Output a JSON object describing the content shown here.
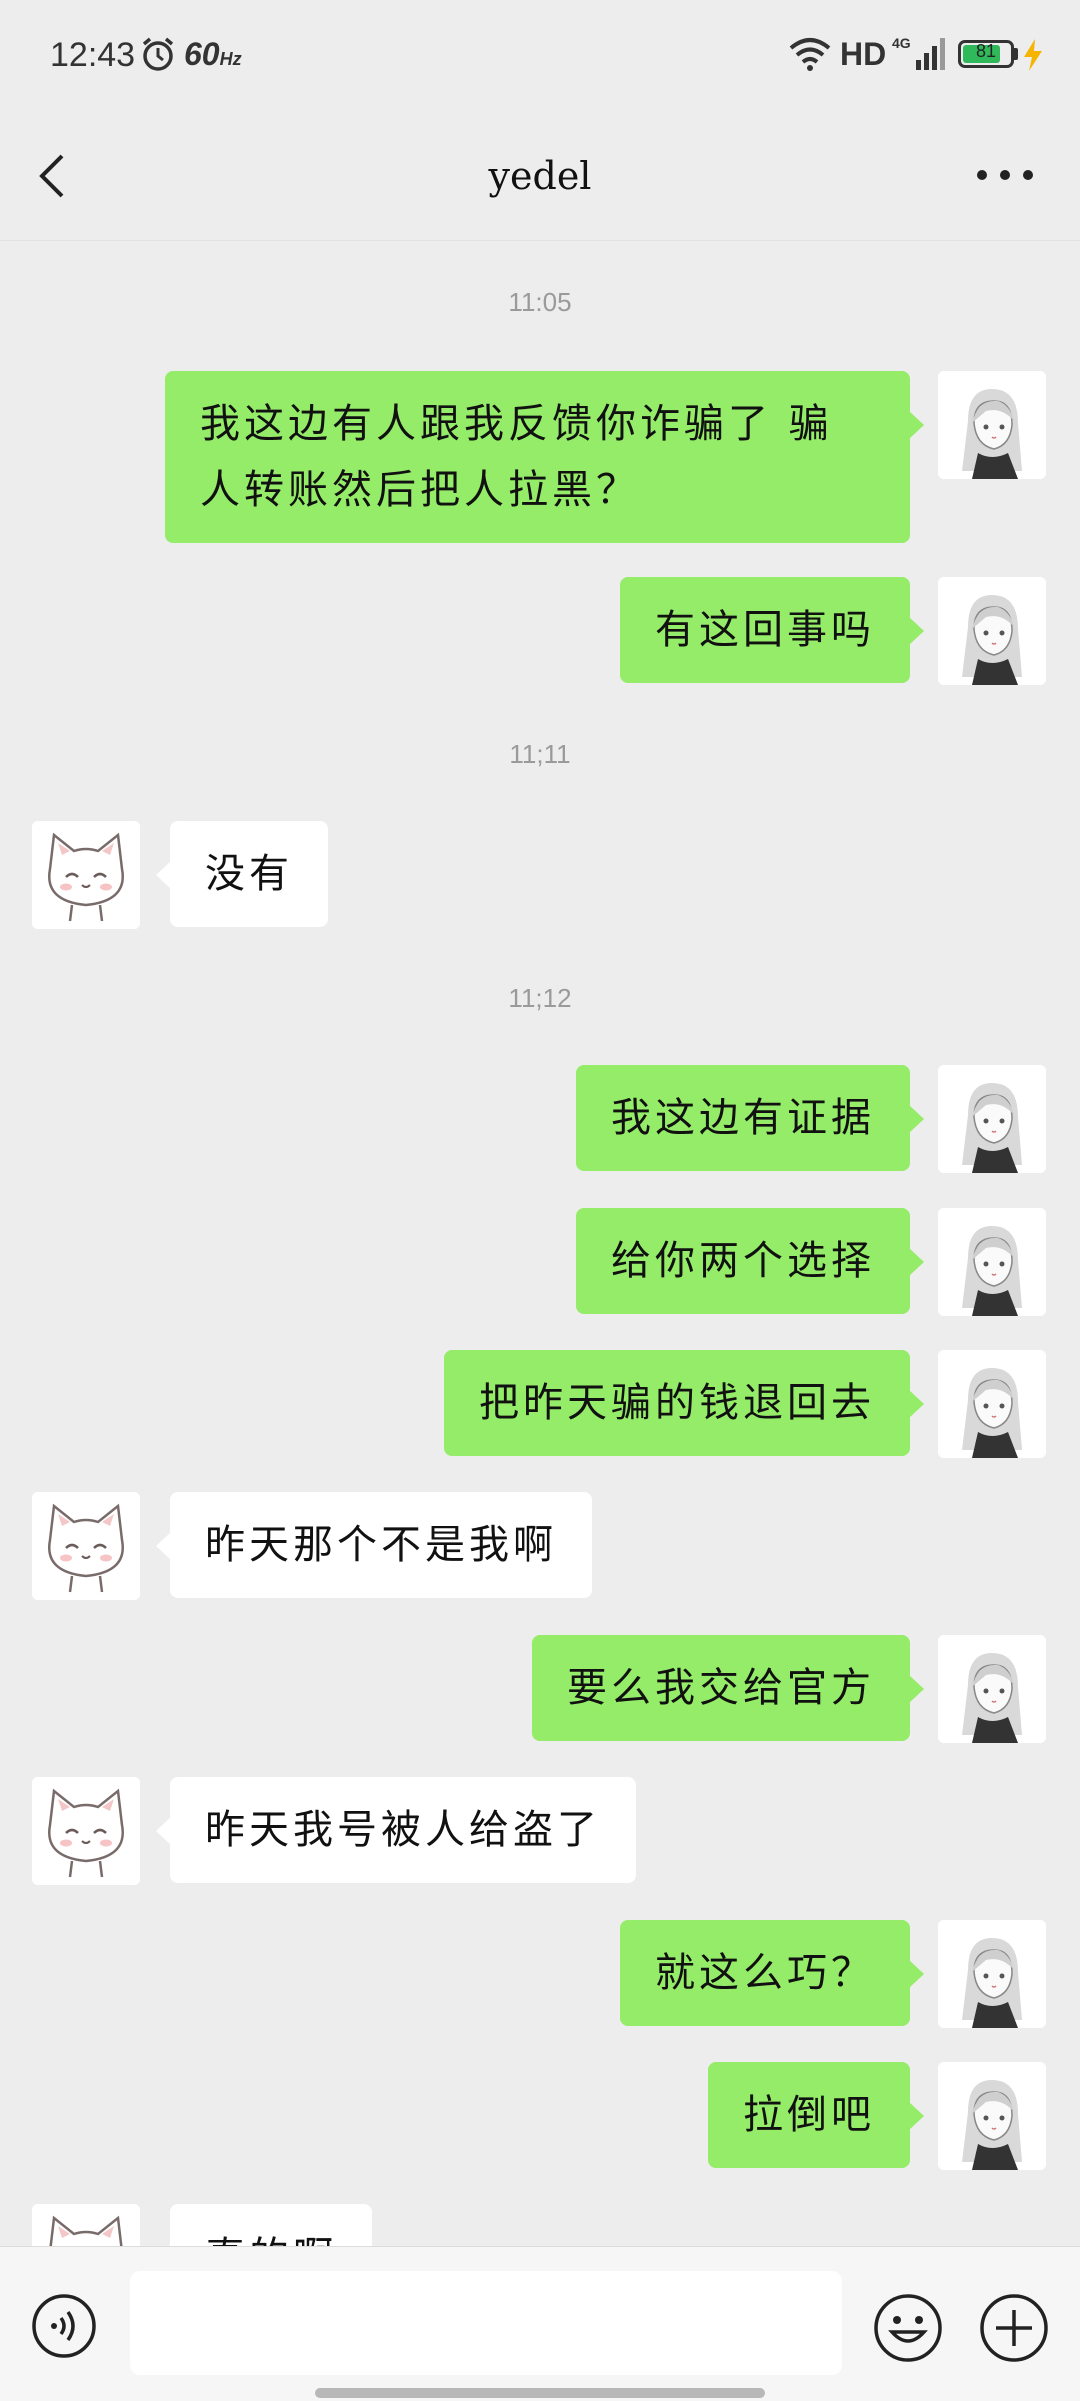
{
  "status_bar": {
    "time": "12:43",
    "refresh_rate": "60",
    "refresh_unit": "Hz",
    "network_type": "HD",
    "signal_label": "4G",
    "battery": "81"
  },
  "header": {
    "title": "yedel"
  },
  "timestamps": [
    "11:05",
    "11;11",
    "11;12"
  ],
  "messages": [
    {
      "text": "我这边有人跟我反馈你诈骗了  骗人转账然后把人拉黑？"
    },
    {
      "text": "有这回事吗"
    },
    {
      "text": "没有"
    },
    {
      "text": "我这边有证据"
    },
    {
      "text": "给你两个选择"
    },
    {
      "text": "把昨天骗的钱退回去"
    },
    {
      "text": "昨天那个不是我啊"
    },
    {
      "text": "要么我交给官方"
    },
    {
      "text": "昨天我号被人给盗了"
    },
    {
      "text": "就这么巧？"
    },
    {
      "text": "拉倒吧"
    },
    {
      "text": "真的啊"
    }
  ],
  "input": {
    "value": "",
    "placeholder": ""
  },
  "colors": {
    "background": "#ededed",
    "my_bubble": "#95ec69",
    "other_bubble": "#ffffff",
    "battery_fill": "#2fb95a"
  },
  "icons": {
    "back": "chevron-left-icon",
    "more": "more-dots-icon",
    "voice": "voice-icon",
    "emoji": "emoji-icon",
    "plus": "plus-icon"
  }
}
